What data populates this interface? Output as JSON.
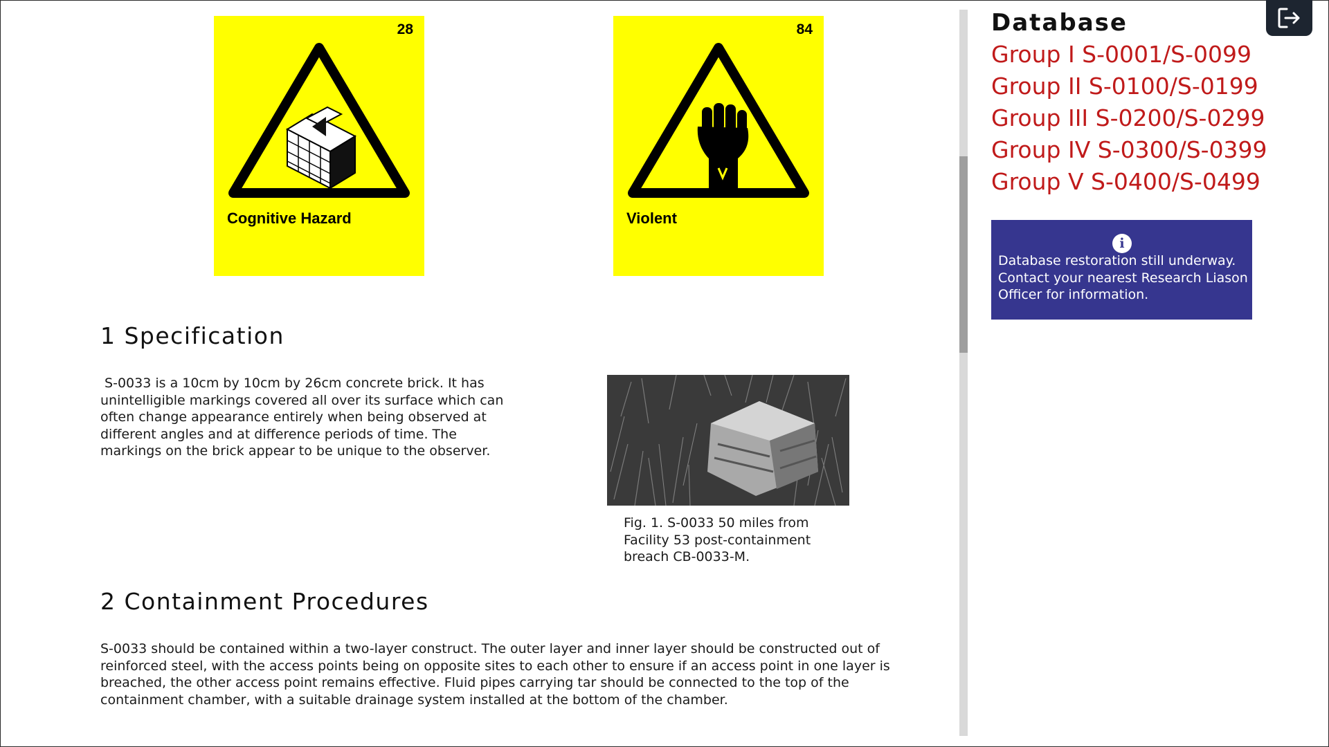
{
  "cards": [
    {
      "number": "28",
      "label": "Cognitive Hazard",
      "icon": "impossible-brick-staircase-icon"
    },
    {
      "number": "84",
      "label": "Violent",
      "icon": "raised-fist-icon"
    }
  ],
  "specification": {
    "heading": "1 Specification",
    "text": " S-0033 is a 10cm by 10cm by 26cm concrete brick. It has unintelligible markings covered all over its surface which can often change appearance entirely when being observed at different angles and at difference periods of time. The markings on the brick appear to be unique to the observer.",
    "figure_caption": "Fig. 1. S-0033 50 miles from Facility 53 post-containment breach CB-0033-M."
  },
  "containment": {
    "heading": "2 Containment Procedures",
    "text": "S-0033 should be contained within a two-layer construct. The outer layer and inner layer should be constructed out of reinforced steel, with the access points being on opposite sites to each other to ensure if an access point in one layer is breached, the other access point remains effective. Fluid pipes carrying tar should be connected to the top of the containment chamber, with a suitable drainage system installed at the bottom of the chamber."
  },
  "sidebar": {
    "title": "Database",
    "groups": [
      "Group I S-0001/S-0099",
      "Group II S-0100/S-0199",
      "Group III S-0200/S-0299",
      "Group IV S-0300/S-0399",
      "Group V S-0400/S-0499"
    ],
    "notice": {
      "icon": "info-icon",
      "icon_glyph": "i",
      "text": "Database restoration still underway. Contact your nearest Research Liason Officer for information."
    }
  },
  "colors": {
    "card_bg": "#ffff00",
    "link": "#c01a1a",
    "notice_bg": "#36368f",
    "logout_bg": "#1d2530"
  },
  "logout_icon": "logout-icon"
}
